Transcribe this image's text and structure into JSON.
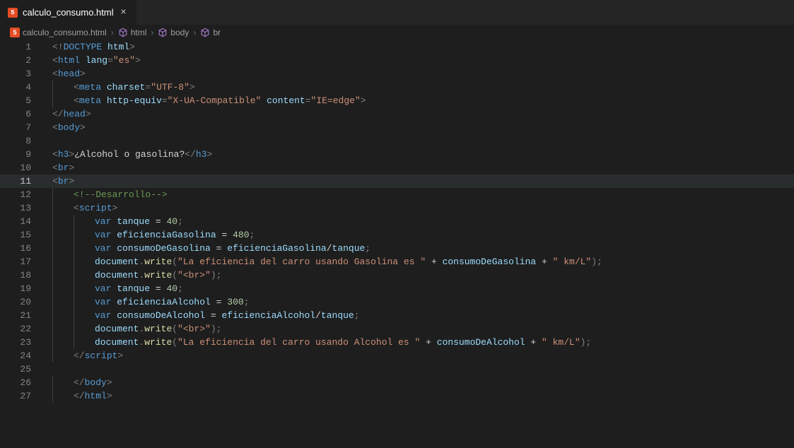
{
  "tab": {
    "filename": "calculo_consumo.html",
    "close_glyph": "×"
  },
  "breadcrumbs": {
    "items": [
      {
        "label": "calculo_consumo.html",
        "icon": "html5"
      },
      {
        "label": "html",
        "icon": "cube"
      },
      {
        "label": "body",
        "icon": "cube"
      },
      {
        "label": "br",
        "icon": "cube"
      }
    ],
    "sep": "›"
  },
  "code": {
    "lines": [
      {
        "n": 1,
        "indent": 0,
        "tokens": [
          [
            "pun",
            "<!"
          ],
          [
            "doctype",
            "DOCTYPE"
          ],
          [
            "text",
            " "
          ],
          [
            "attr",
            "html"
          ],
          [
            "pun",
            ">"
          ]
        ]
      },
      {
        "n": 2,
        "indent": 0,
        "tokens": [
          [
            "pun",
            "<"
          ],
          [
            "tag",
            "html"
          ],
          [
            "text",
            " "
          ],
          [
            "attr",
            "lang"
          ],
          [
            "pun",
            "="
          ],
          [
            "str",
            "\"es\""
          ],
          [
            "pun",
            ">"
          ]
        ]
      },
      {
        "n": 3,
        "indent": 0,
        "tokens": [
          [
            "pun",
            "<"
          ],
          [
            "tag",
            "head"
          ],
          [
            "pun",
            ">"
          ]
        ]
      },
      {
        "n": 4,
        "indent": 1,
        "tokens": [
          [
            "pun",
            "<"
          ],
          [
            "tag",
            "meta"
          ],
          [
            "text",
            " "
          ],
          [
            "attr",
            "charset"
          ],
          [
            "pun",
            "="
          ],
          [
            "str",
            "\"UTF-8\""
          ],
          [
            "pun",
            ">"
          ]
        ]
      },
      {
        "n": 5,
        "indent": 1,
        "tokens": [
          [
            "pun",
            "<"
          ],
          [
            "tag",
            "meta"
          ],
          [
            "text",
            " "
          ],
          [
            "attr",
            "http-equiv"
          ],
          [
            "pun",
            "="
          ],
          [
            "str",
            "\"X-UA-Compatible\""
          ],
          [
            "text",
            " "
          ],
          [
            "attr",
            "content"
          ],
          [
            "pun",
            "="
          ],
          [
            "str",
            "\"IE=edge\""
          ],
          [
            "pun",
            ">"
          ]
        ]
      },
      {
        "n": 6,
        "indent": 0,
        "tokens": [
          [
            "pun",
            "</"
          ],
          [
            "tag",
            "head"
          ],
          [
            "pun",
            ">"
          ]
        ]
      },
      {
        "n": 7,
        "indent": 0,
        "tokens": [
          [
            "pun",
            "<"
          ],
          [
            "tag",
            "body"
          ],
          [
            "pun",
            ">"
          ]
        ]
      },
      {
        "n": 8,
        "indent": 0,
        "tokens": []
      },
      {
        "n": 9,
        "indent": 0,
        "tokens": [
          [
            "pun",
            "<"
          ],
          [
            "tag",
            "h3"
          ],
          [
            "pun",
            ">"
          ],
          [
            "text",
            "¿Alcohol o gasolina?"
          ],
          [
            "pun",
            "</"
          ],
          [
            "tag",
            "h3"
          ],
          [
            "pun",
            ">"
          ]
        ]
      },
      {
        "n": 10,
        "indent": 0,
        "tokens": [
          [
            "pun",
            "<"
          ],
          [
            "tag",
            "br"
          ],
          [
            "pun",
            ">"
          ]
        ]
      },
      {
        "n": 11,
        "indent": 0,
        "current": true,
        "tokens": [
          [
            "pun",
            "<"
          ],
          [
            "tag",
            "br"
          ],
          [
            "pun",
            ">"
          ]
        ]
      },
      {
        "n": 12,
        "indent": 1,
        "tokens": [
          [
            "comment",
            "<!--Desarrollo-->"
          ]
        ]
      },
      {
        "n": 13,
        "indent": 1,
        "tokens": [
          [
            "pun",
            "<"
          ],
          [
            "tag",
            "script"
          ],
          [
            "pun",
            ">"
          ]
        ]
      },
      {
        "n": 14,
        "indent": 2,
        "tokens": [
          [
            "kw",
            "var"
          ],
          [
            "text",
            " "
          ],
          [
            "var",
            "tanque"
          ],
          [
            "text",
            " "
          ],
          [
            "op",
            "="
          ],
          [
            "text",
            " "
          ],
          [
            "num",
            "40"
          ],
          [
            "pun",
            ";"
          ]
        ]
      },
      {
        "n": 15,
        "indent": 2,
        "tokens": [
          [
            "kw",
            "var"
          ],
          [
            "text",
            " "
          ],
          [
            "var",
            "eficienciaGasolina"
          ],
          [
            "text",
            " "
          ],
          [
            "op",
            "="
          ],
          [
            "text",
            " "
          ],
          [
            "num",
            "480"
          ],
          [
            "pun",
            ";"
          ]
        ]
      },
      {
        "n": 16,
        "indent": 2,
        "tokens": [
          [
            "kw",
            "var"
          ],
          [
            "text",
            " "
          ],
          [
            "var",
            "consumoDeGasolina"
          ],
          [
            "text",
            " "
          ],
          [
            "op",
            "="
          ],
          [
            "text",
            " "
          ],
          [
            "var",
            "eficienciaGasolina"
          ],
          [
            "op",
            "/"
          ],
          [
            "var",
            "tanque"
          ],
          [
            "pun",
            ";"
          ]
        ]
      },
      {
        "n": 17,
        "indent": 2,
        "tokens": [
          [
            "obj",
            "document"
          ],
          [
            "pun",
            "."
          ],
          [
            "fn",
            "write"
          ],
          [
            "pun",
            "("
          ],
          [
            "str",
            "\"La eficiencia del carro usando Gasolina es \""
          ],
          [
            "text",
            " "
          ],
          [
            "op",
            "+"
          ],
          [
            "text",
            " "
          ],
          [
            "var",
            "consumoDeGasolina"
          ],
          [
            "text",
            " "
          ],
          [
            "op",
            "+"
          ],
          [
            "text",
            " "
          ],
          [
            "str",
            "\" km/L\""
          ],
          [
            "pun",
            ");"
          ]
        ]
      },
      {
        "n": 18,
        "indent": 2,
        "tokens": [
          [
            "obj",
            "document"
          ],
          [
            "pun",
            "."
          ],
          [
            "fn",
            "write"
          ],
          [
            "pun",
            "("
          ],
          [
            "str",
            "\"<br>\""
          ],
          [
            "pun",
            ");"
          ]
        ]
      },
      {
        "n": 19,
        "indent": 2,
        "tokens": [
          [
            "kw",
            "var"
          ],
          [
            "text",
            " "
          ],
          [
            "var",
            "tanque"
          ],
          [
            "text",
            " "
          ],
          [
            "op",
            "="
          ],
          [
            "text",
            " "
          ],
          [
            "num",
            "40"
          ],
          [
            "pun",
            ";"
          ]
        ]
      },
      {
        "n": 20,
        "indent": 2,
        "tokens": [
          [
            "kw",
            "var"
          ],
          [
            "text",
            " "
          ],
          [
            "var",
            "eficienciaAlcohol"
          ],
          [
            "text",
            " "
          ],
          [
            "op",
            "="
          ],
          [
            "text",
            " "
          ],
          [
            "num",
            "300"
          ],
          [
            "pun",
            ";"
          ]
        ]
      },
      {
        "n": 21,
        "indent": 2,
        "tokens": [
          [
            "kw",
            "var"
          ],
          [
            "text",
            " "
          ],
          [
            "var",
            "consumoDeAlcohol"
          ],
          [
            "text",
            " "
          ],
          [
            "op",
            "="
          ],
          [
            "text",
            " "
          ],
          [
            "var",
            "eficienciaAlcohol"
          ],
          [
            "op",
            "/"
          ],
          [
            "var",
            "tanque"
          ],
          [
            "pun",
            ";"
          ]
        ]
      },
      {
        "n": 22,
        "indent": 2,
        "tokens": [
          [
            "obj",
            "document"
          ],
          [
            "pun",
            "."
          ],
          [
            "fn",
            "write"
          ],
          [
            "pun",
            "("
          ],
          [
            "str",
            "\"<br>\""
          ],
          [
            "pun",
            ");"
          ]
        ]
      },
      {
        "n": 23,
        "indent": 2,
        "tokens": [
          [
            "obj",
            "document"
          ],
          [
            "pun",
            "."
          ],
          [
            "fn",
            "write"
          ],
          [
            "pun",
            "("
          ],
          [
            "str",
            "\"La eficiencia del carro usando Alcohol es \""
          ],
          [
            "text",
            " "
          ],
          [
            "op",
            "+"
          ],
          [
            "text",
            " "
          ],
          [
            "var",
            "consumoDeAlcohol"
          ],
          [
            "text",
            " "
          ],
          [
            "op",
            "+"
          ],
          [
            "text",
            " "
          ],
          [
            "str",
            "\"  km/L\""
          ],
          [
            "pun",
            ");"
          ]
        ]
      },
      {
        "n": 24,
        "indent": 1,
        "tokens": [
          [
            "pun",
            "</"
          ],
          [
            "tag",
            "script"
          ],
          [
            "pun",
            ">"
          ]
        ]
      },
      {
        "n": 25,
        "indent": 0,
        "tokens": []
      },
      {
        "n": 26,
        "indent": 1,
        "tokens": [
          [
            "pun",
            "</"
          ],
          [
            "tag",
            "body"
          ],
          [
            "pun",
            ">"
          ]
        ]
      },
      {
        "n": 27,
        "indent": 1,
        "tokens": [
          [
            "pun",
            "</"
          ],
          [
            "tag",
            "html"
          ],
          [
            "pun",
            ">"
          ]
        ]
      }
    ]
  }
}
